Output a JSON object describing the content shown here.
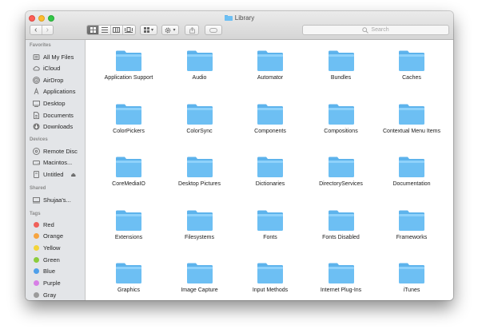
{
  "window": {
    "title": "Library"
  },
  "toolbar": {
    "back": "‹",
    "forward": "›",
    "view_modes": [
      "icon-view",
      "list-view",
      "column-view",
      "cover-flow-view"
    ],
    "arrange_caret": "▾",
    "action_caret": "▾",
    "search_placeholder": "Search"
  },
  "sidebar": {
    "favorites_header": "Favorites",
    "favorites": [
      {
        "label": "All My Files",
        "icon": "all-files-icon"
      },
      {
        "label": "iCloud",
        "icon": "icloud-icon"
      },
      {
        "label": "AirDrop",
        "icon": "airdrop-icon"
      },
      {
        "label": "Applications",
        "icon": "applications-icon"
      },
      {
        "label": "Desktop",
        "icon": "desktop-icon"
      },
      {
        "label": "Documents",
        "icon": "documents-icon"
      },
      {
        "label": "Downloads",
        "icon": "downloads-icon"
      }
    ],
    "devices_header": "Devices",
    "devices": [
      {
        "label": "Remote Disc",
        "icon": "remote-disc-icon"
      },
      {
        "label": "Macintos...",
        "icon": "hard-drive-icon"
      },
      {
        "label": "Untitled",
        "icon": "disk-icon",
        "eject": "⏏"
      }
    ],
    "shared_header": "Shared",
    "shared": [
      {
        "label": "Shujaa's...",
        "icon": "computer-icon"
      }
    ],
    "tags_header": "Tags",
    "tags": [
      {
        "label": "Red",
        "color": "#f0605a"
      },
      {
        "label": "Orange",
        "color": "#f6a440"
      },
      {
        "label": "Yellow",
        "color": "#f3d43a"
      },
      {
        "label": "Green",
        "color": "#8ccc3c"
      },
      {
        "label": "Blue",
        "color": "#4fa0ea"
      },
      {
        "label": "Purple",
        "color": "#d77fe6"
      },
      {
        "label": "Gray",
        "color": "#9b9b9b"
      }
    ]
  },
  "folders": [
    "Application Support",
    "Audio",
    "Automator",
    "Bundles",
    "Caches",
    "ColorPickers",
    "ColorSync",
    "Components",
    "Compositions",
    "Contextual Menu Items",
    "CoreMediaIO",
    "Desktop Pictures",
    "Dictionaries",
    "DirectoryServices",
    "Documentation",
    "Extensions",
    "Filesystems",
    "Fonts",
    "Fonts Disabled",
    "Frameworks",
    "Graphics",
    "Image Capture",
    "Input Methods",
    "Internet Plug-Ins",
    "iTunes"
  ],
  "colors": {
    "folder_top": "#8fd2fb",
    "folder_body": "#6dbff3",
    "folder_tab": "#5db3ec",
    "sidebar_bg": "#e3e5e8"
  }
}
